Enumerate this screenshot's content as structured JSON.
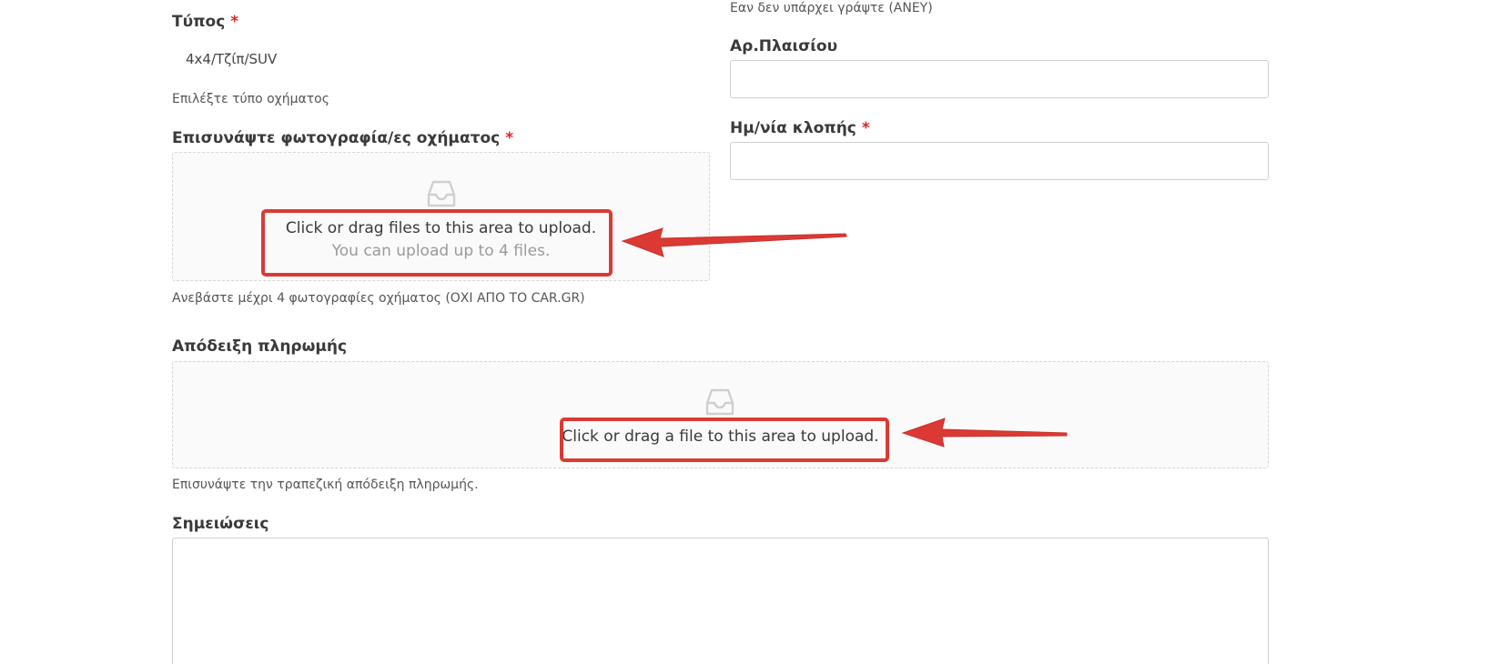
{
  "form": {
    "type": {
      "label": "Τύπος",
      "required_mark": "*",
      "value": "4x4/Τζίπ/SUV",
      "help": "Επιλέξτε τύπο οχήματος"
    },
    "top_hint": "Εαν δεν υπάρχει γράψτε (ΑΝΕΥ)",
    "frame_number": {
      "label": "Αρ.Πλαισίου",
      "value": ""
    },
    "theft_date": {
      "label": "Ημ/νία κλοπής",
      "required_mark": "*",
      "value": ""
    },
    "vehicle_photos": {
      "label": "Επισυνάψτε φωτογραφία/ες οχήματος",
      "required_mark": "*",
      "drop_text": "Click or drag files to this area to upload.",
      "drop_hint": "You can upload up to 4 files.",
      "help": "Ανεβάστε μέχρι 4 φωτογραφίες οχήματος (ΟΧΙ ΑΠΟ ΤΟ CAR.GR)"
    },
    "payment_proof": {
      "label": "Απόδειξη πληρωμής",
      "drop_text": "Click or drag a file to this area to upload.",
      "help": "Επισυνάψτε την τραπεζική απόδειξη πληρωμής."
    },
    "notes": {
      "label": "Σημειώσεις",
      "value": ""
    }
  },
  "icons": {
    "upload": "inbox-icon"
  },
  "colors": {
    "annotation": "#db3a34",
    "required": "#e02424"
  }
}
